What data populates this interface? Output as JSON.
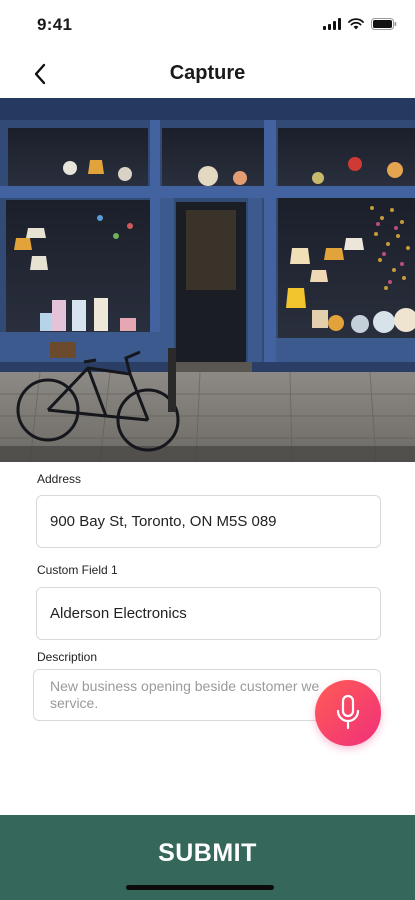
{
  "status_bar": {
    "time": "9:41",
    "icons": [
      "cellular-signal-icon",
      "wifi-icon",
      "battery-icon"
    ]
  },
  "nav": {
    "title": "Capture",
    "back_icon": "chevron-left-icon"
  },
  "photo": {
    "subject": "storefront-photo"
  },
  "form": {
    "address": {
      "label": "Address",
      "value": "900 Bay St, Toronto, ON M5S 089"
    },
    "custom_field_1": {
      "label": "Custom Field 1",
      "value": "Alderson Electronics"
    },
    "description": {
      "label": "Description",
      "placeholder": "New business opening beside customer we service."
    }
  },
  "mic": {
    "icon": "microphone-icon"
  },
  "submit": {
    "label": "SUBMIT"
  },
  "colors": {
    "submit_bg": "#35675a",
    "mic_gradient_start": "#ff5c56",
    "mic_gradient_end": "#f02f7a"
  }
}
